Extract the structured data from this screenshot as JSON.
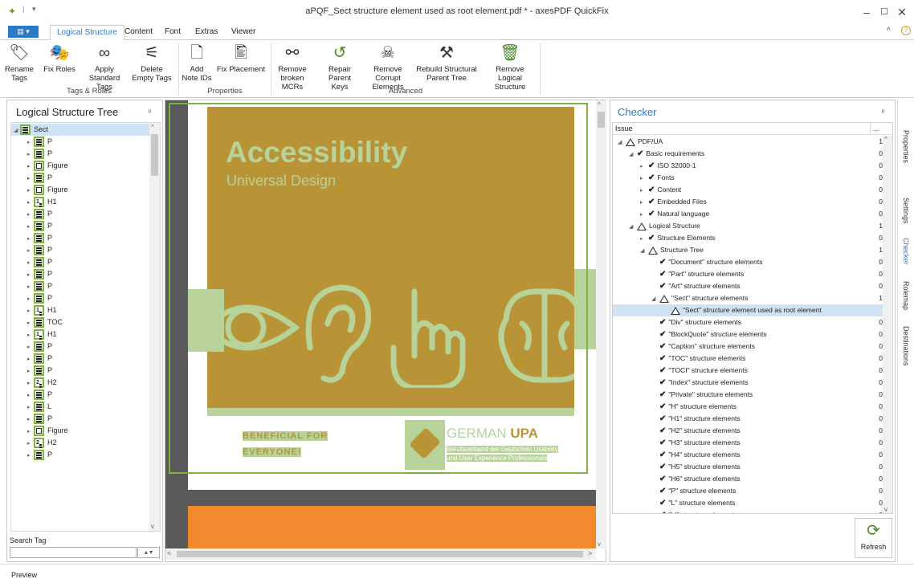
{
  "app": {
    "title": "aPQF_Sect structure element used as root element.pdf * - axesPDF QuickFix",
    "status": "Preview"
  },
  "window_controls": {
    "minimize": "–",
    "maximize": "☐",
    "close": "✕",
    "collapse": "^",
    "help": "?"
  },
  "ribbon_tabs": [
    "Logical Structure",
    "Content",
    "Font",
    "Extras",
    "Viewer"
  ],
  "ribbon": {
    "tags_roles": {
      "group_label": "Tags & Roles",
      "buttons": [
        {
          "label": "Rename Tags",
          "icon": "rename-tags-icon"
        },
        {
          "label": "Fix Roles",
          "icon": "fix-roles-icon"
        },
        {
          "label": "Apply Standard Tags",
          "icon": "apply-standard-tags-icon"
        },
        {
          "label": "Delete Empty Tags",
          "icon": "delete-empty-tags-icon"
        }
      ]
    },
    "properties": {
      "group_label": "Properties",
      "buttons": [
        {
          "label": "Add Note IDs",
          "icon": "add-note-ids-icon"
        },
        {
          "label": "Fix Placement",
          "icon": "fix-placement-icon"
        }
      ]
    },
    "advanced": {
      "group_label": "Advanced",
      "buttons": [
        {
          "label": "Remove broken MCRs",
          "icon": "remove-broken-mcrs-icon"
        },
        {
          "label": "Repair Parent Keys",
          "icon": "repair-parent-keys-icon"
        },
        {
          "label": "Remove Corrupt Elements",
          "icon": "remove-corrupt-elements-icon"
        },
        {
          "label": "Rebuild Structural Parent Tree",
          "icon": "rebuild-parent-tree-icon"
        },
        {
          "label": "Remove Logical Structure",
          "icon": "remove-logical-structure-icon"
        }
      ]
    }
  },
  "left_panel": {
    "title": "Logical Structure Tree",
    "pin": "ᵖ",
    "search_label": "Search Tag",
    "search_value": "",
    "tree": [
      {
        "label": "Sect",
        "kind": "sect",
        "expanded": true
      },
      {
        "label": "P",
        "kind": "p"
      },
      {
        "label": "P",
        "kind": "p"
      },
      {
        "label": "Figure",
        "kind": "figure"
      },
      {
        "label": "P",
        "kind": "p"
      },
      {
        "label": "Figure",
        "kind": "figure"
      },
      {
        "label": "H1",
        "kind": "h1"
      },
      {
        "label": "P",
        "kind": "p"
      },
      {
        "label": "P",
        "kind": "p"
      },
      {
        "label": "P",
        "kind": "p"
      },
      {
        "label": "P",
        "kind": "p"
      },
      {
        "label": "P",
        "kind": "p"
      },
      {
        "label": "P",
        "kind": "p"
      },
      {
        "label": "P",
        "kind": "p"
      },
      {
        "label": "P",
        "kind": "p"
      },
      {
        "label": "H1",
        "kind": "h1"
      },
      {
        "label": "TOC",
        "kind": "toc"
      },
      {
        "label": "H1",
        "kind": "h1"
      },
      {
        "label": "P",
        "kind": "p"
      },
      {
        "label": "P",
        "kind": "p"
      },
      {
        "label": "P",
        "kind": "p"
      },
      {
        "label": "H2",
        "kind": "h2"
      },
      {
        "label": "P",
        "kind": "p"
      },
      {
        "label": "L",
        "kind": "l"
      },
      {
        "label": "P",
        "kind": "p"
      },
      {
        "label": "Figure",
        "kind": "figure"
      },
      {
        "label": "H2",
        "kind": "h2"
      },
      {
        "label": "P",
        "kind": "p"
      }
    ]
  },
  "document": {
    "heading": "Accessibility",
    "subheading": "Universal Design",
    "tagline_line1": "BENEFICIAL FOR",
    "tagline_line2": "EVERYONE!",
    "org_name_light": "GERMAN ",
    "org_name_bold": "UPA",
    "org_desc_line1": "Berufsverband der Deutschen Usability",
    "org_desc_line2": "und User Experience Professionals",
    "colors": {
      "cover": "#b89436",
      "accent": "#b7d39a",
      "orange": "#f3892e",
      "dark": "#555555"
    }
  },
  "checker": {
    "title": "Checker",
    "column_header": "Issue",
    "column_menu": "...",
    "refresh_label": "Refresh",
    "rows": [
      {
        "label": "PDF/UA",
        "count": "1",
        "level": 0,
        "status": "warn",
        "expand": "open"
      },
      {
        "label": "Basic requirements",
        "count": "0",
        "level": 1,
        "status": "ok",
        "expand": "open"
      },
      {
        "label": "ISO 32000-1",
        "count": "0",
        "level": 2,
        "status": "ok",
        "expand": "closed"
      },
      {
        "label": "Fonts",
        "count": "0",
        "level": 2,
        "status": "ok",
        "expand": "closed"
      },
      {
        "label": "Content",
        "count": "0",
        "level": 2,
        "status": "ok",
        "expand": "closed"
      },
      {
        "label": "Embedded Files",
        "count": "0",
        "level": 2,
        "status": "ok",
        "expand": "closed"
      },
      {
        "label": "Natural language",
        "count": "0",
        "level": 2,
        "status": "ok",
        "expand": "closed"
      },
      {
        "label": "Logical Structure",
        "count": "1",
        "level": 1,
        "status": "warn",
        "expand": "open"
      },
      {
        "label": "Structure Elements",
        "count": "0",
        "level": 2,
        "status": "ok",
        "expand": "closed"
      },
      {
        "label": "Structure Tree",
        "count": "1",
        "level": 2,
        "status": "warn",
        "expand": "open"
      },
      {
        "label": "\"Document\" structure elements",
        "count": "0",
        "level": 3,
        "status": "ok",
        "expand": "none"
      },
      {
        "label": "\"Part\" structure elements",
        "count": "0",
        "level": 3,
        "status": "ok",
        "expand": "none"
      },
      {
        "label": "\"Art\" structure elements",
        "count": "0",
        "level": 3,
        "status": "ok",
        "expand": "none"
      },
      {
        "label": "\"Sect\" structure elements",
        "count": "1",
        "level": 3,
        "status": "warn",
        "expand": "open"
      },
      {
        "label": "\"Sect\" structure element used as root element",
        "count": "",
        "level": 4,
        "status": "warn",
        "expand": "none",
        "selected": true
      },
      {
        "label": "\"Div\" structure elements",
        "count": "0",
        "level": 3,
        "status": "ok",
        "expand": "none"
      },
      {
        "label": "\"BlockQuote\" structure elements",
        "count": "0",
        "level": 3,
        "status": "ok",
        "expand": "none"
      },
      {
        "label": "\"Caption\" structure elements",
        "count": "0",
        "level": 3,
        "status": "ok",
        "expand": "none"
      },
      {
        "label": "\"TOC\" structure elements",
        "count": "0",
        "level": 3,
        "status": "ok",
        "expand": "none"
      },
      {
        "label": "\"TOCI\" structure elements",
        "count": "0",
        "level": 3,
        "status": "ok",
        "expand": "none"
      },
      {
        "label": "\"Index\" structure elements",
        "count": "0",
        "level": 3,
        "status": "ok",
        "expand": "none"
      },
      {
        "label": "\"Private\" structure elements",
        "count": "0",
        "level": 3,
        "status": "ok",
        "expand": "none"
      },
      {
        "label": "\"H\" structure elements",
        "count": "0",
        "level": 3,
        "status": "ok",
        "expand": "none"
      },
      {
        "label": "\"H1\" structure elements",
        "count": "0",
        "level": 3,
        "status": "ok",
        "expand": "none"
      },
      {
        "label": "\"H2\" structure elements",
        "count": "0",
        "level": 3,
        "status": "ok",
        "expand": "none"
      },
      {
        "label": "\"H3\" structure elements",
        "count": "0",
        "level": 3,
        "status": "ok",
        "expand": "none"
      },
      {
        "label": "\"H4\" structure elements",
        "count": "0",
        "level": 3,
        "status": "ok",
        "expand": "none"
      },
      {
        "label": "\"H5\" structure elements",
        "count": "0",
        "level": 3,
        "status": "ok",
        "expand": "none"
      },
      {
        "label": "\"H6\" structure elements",
        "count": "0",
        "level": 3,
        "status": "ok",
        "expand": "none"
      },
      {
        "label": "\"P\" structure elements",
        "count": "0",
        "level": 3,
        "status": "ok",
        "expand": "none"
      },
      {
        "label": "\"L\" structure elements",
        "count": "0",
        "level": 3,
        "status": "ok",
        "expand": "none"
      },
      {
        "label": "\"LI\" structure elements",
        "count": "0",
        "level": 3,
        "status": "ok",
        "expand": "none"
      }
    ]
  },
  "side_tabs": [
    "Properties",
    "Settings",
    "Checker",
    "Rolemap",
    "Destinations"
  ]
}
